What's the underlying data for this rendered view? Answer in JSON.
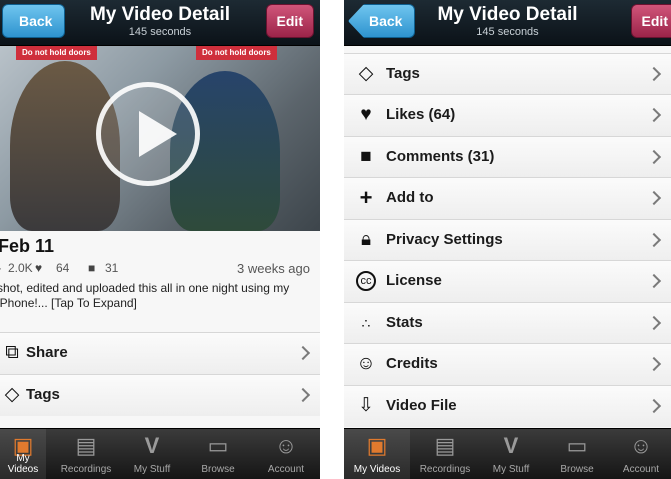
{
  "header": {
    "title": "My Video Detail",
    "subtitle": "145 seconds",
    "back_label": "Back",
    "edit_label": "Edit"
  },
  "video": {
    "title": "Feb 11",
    "plays": "2.0K",
    "likes": "64",
    "comments": "31",
    "age": "3 weeks ago",
    "description": "shot, edited and uploaded this all in one night using my iPhone!... [Tap To Expand]",
    "sticker_text": "Do not hold doors"
  },
  "left_rows": [
    {
      "label": "Share",
      "icon": "share-icon"
    },
    {
      "label": "Tags",
      "icon": "tag-icon"
    }
  ],
  "right_rows": [
    {
      "label": "Tags",
      "icon": "tag-icon"
    },
    {
      "label": "Likes (64)",
      "icon": "heart-icon"
    },
    {
      "label": "Comments (31)",
      "icon": "comment-icon"
    },
    {
      "label": "Add to",
      "icon": "plus-icon"
    },
    {
      "label": "Privacy Settings",
      "icon": "lock-icon"
    },
    {
      "label": "License",
      "icon": "cc-license-icon"
    },
    {
      "label": "Stats",
      "icon": "stats-icon"
    },
    {
      "label": "Credits",
      "icon": "smiley-icon"
    },
    {
      "label": "Video File",
      "icon": "download-tray-icon"
    }
  ],
  "tabs": [
    {
      "label": "My Videos",
      "icon": "video-film-icon",
      "active": true
    },
    {
      "label": "Recordings",
      "icon": "clapperboard-icon",
      "active": false
    },
    {
      "label": "My Stuff",
      "icon": "vimeo-v-icon",
      "active": false
    },
    {
      "label": "Browse",
      "icon": "tv-icon",
      "active": false
    },
    {
      "label": "Account",
      "icon": "smiley-icon",
      "active": false
    }
  ],
  "colors": {
    "nav_bg": "#0b1218",
    "back_button": "#2e93cf",
    "edit_button": "#9c2449",
    "active_tab_icon": "#e07a2e"
  }
}
